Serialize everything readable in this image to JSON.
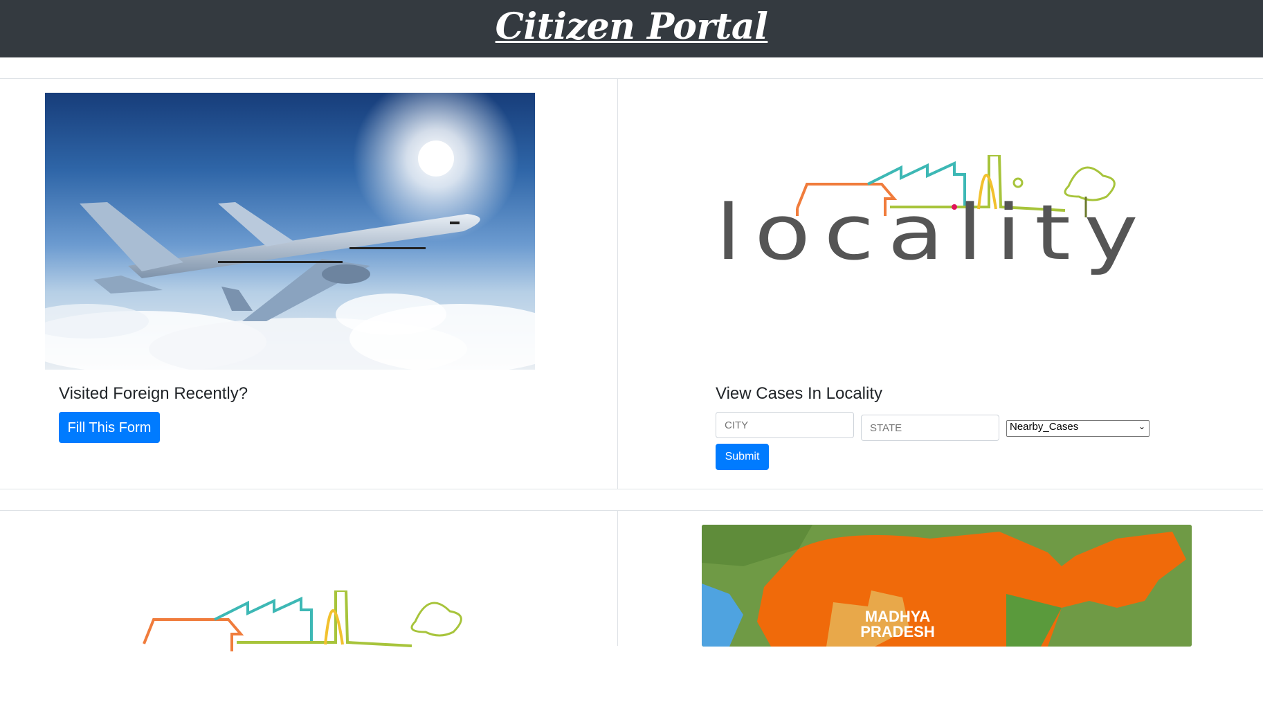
{
  "header": {
    "title": "Citizen Portal"
  },
  "foreign_card": {
    "title": "Visited Foreign Recently?",
    "button_label": "Fill This Form"
  },
  "locality_card": {
    "logo_text": "locality",
    "title": "View Cases In Locality",
    "city_placeholder": "CITY",
    "state_placeholder": "STATE",
    "select_value": "Nearby_Cases",
    "submit_label": "Submit"
  },
  "map_card": {
    "map_label_line1": "MADHYA",
    "map_label_line2": "PRADESH"
  },
  "colors": {
    "navbar": "#343a40",
    "primary": "#007bff"
  }
}
